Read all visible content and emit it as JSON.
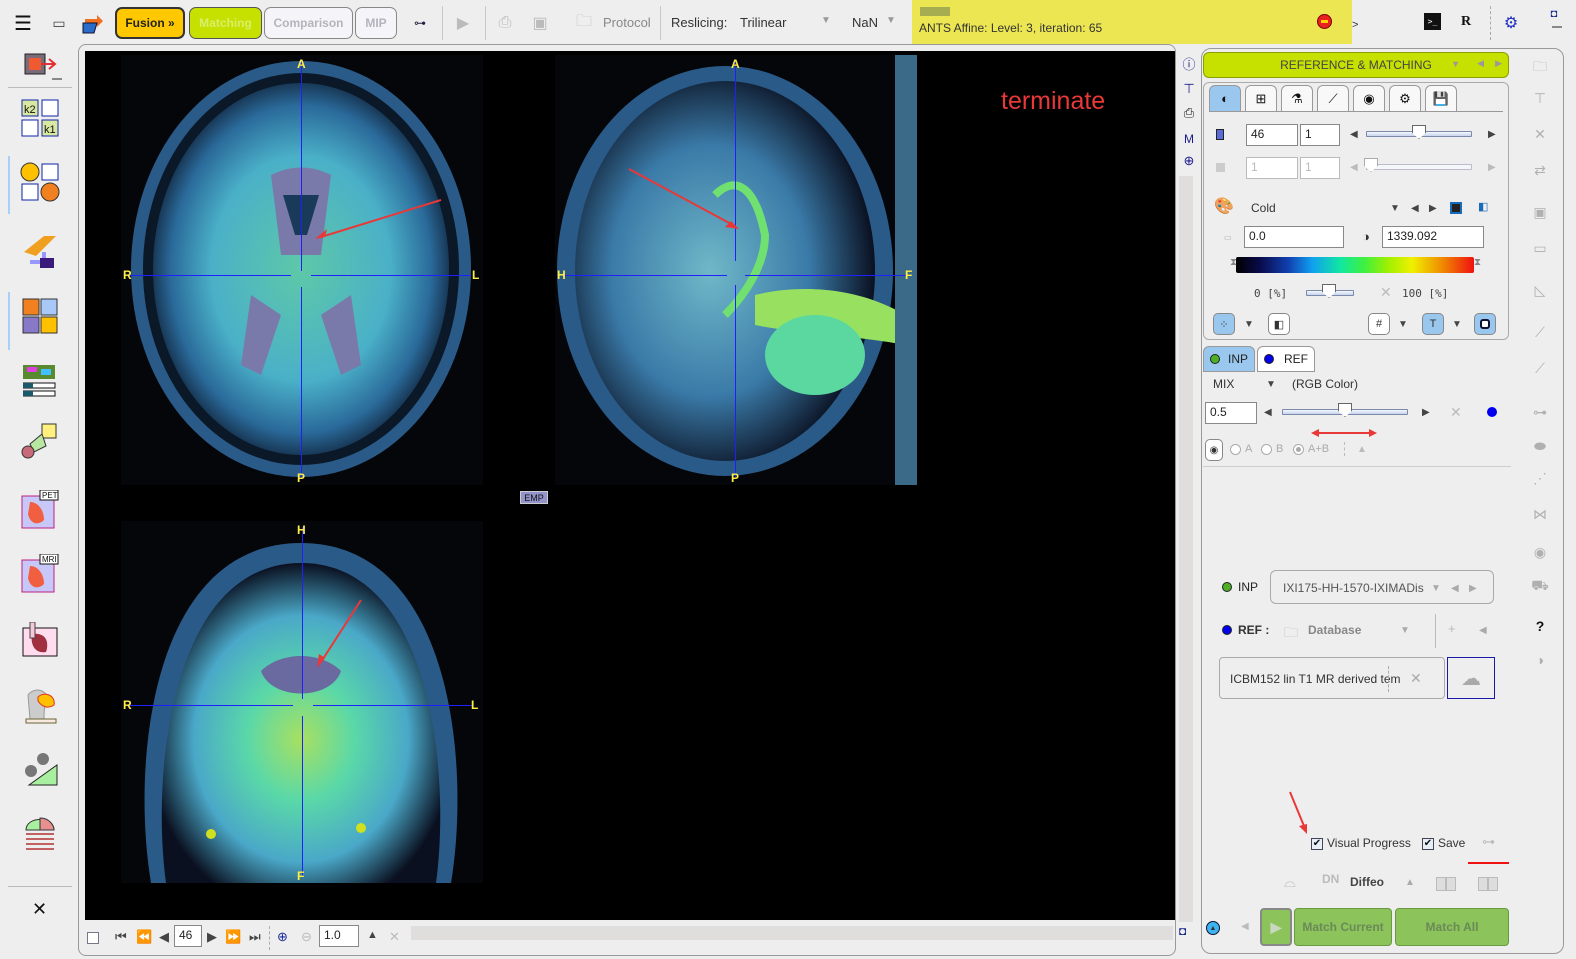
{
  "toolbar": {
    "menu_icon": "hamburger-menu-icon",
    "fusion_label": "Fusion »",
    "matching_label": "Matching",
    "comparison_label": "Comparison",
    "mip_label": "MIP",
    "protocol_label": "Protocol",
    "reslicing_label": "Reslicing:",
    "reslicing_value": "Trilinear",
    "nan_value": "NaN",
    "progress_text": "ANTS Affine: Level: 3, iteration: 65",
    "more_label": ">",
    "r_label": "R",
    "console_label": ">_"
  },
  "annotation": {
    "terminate_label": "terminate"
  },
  "viewer": {
    "axial": {
      "top": "A",
      "bottom": "P",
      "left": "R",
      "right": "L"
    },
    "sagittal": {
      "top": "A",
      "bottom": "P",
      "left": "H",
      "right": "F"
    },
    "coronal": {
      "top": "H",
      "bottom": "F",
      "left": "R",
      "right": "L"
    },
    "emp_label": "EMP",
    "slice_number": "46",
    "zoom_value": "1.0"
  },
  "right_panel": {
    "header_title": "REFERENCE & MATCHING",
    "tabs": [
      "contrast-tab",
      "layout-tab",
      "segmentation-tab",
      "plot-tab",
      "fusion-tab",
      "settings-tab",
      "save-tab"
    ],
    "slice_field": "46",
    "frame_field": "1",
    "slice_slider_fraction": 0.5,
    "secondary_field_1": "1",
    "secondary_field_2": "1",
    "colormap_name": "Cold",
    "min_value": "0.0",
    "max_value": "1339.092",
    "range_low_label": "0  [%]",
    "range_high_label": "100  [%]",
    "inp_tab_label": "INP",
    "ref_tab_label": "REF",
    "mix_label": "MIX",
    "mix_mode": "(RGB Color)",
    "mix_value": "0.5",
    "mix_slider_fraction": 0.5,
    "radio_a": "A",
    "radio_b": "B",
    "radio_ab": "A+B",
    "radio_selected": "A+B",
    "inp_label": "INP",
    "inp_series": "IXI175-HH-1570-IXIMADis",
    "ref_label": "REF :",
    "ref_source": "Database",
    "ref_series": "ICBM152 lin T1 MR derived tem",
    "visual_progress_label": "Visual Progress",
    "visual_progress_checked": true,
    "save_label": "Save",
    "save_checked": true,
    "method_label": "Diffeo",
    "match_current_label": "Match Current",
    "match_all_label": "Match All"
  },
  "colors": {
    "fusion_button": "#ffc800",
    "matching_button": "#c6e000",
    "progress_bar_bg": "#ece653",
    "match_buttons": "#8cc35a",
    "crosshair": "#2020ff",
    "orientation_labels": "#ffee44",
    "annotation_red": "#e83838",
    "inp_dot": "#4caf25",
    "ref_dot": "#0000ee"
  }
}
